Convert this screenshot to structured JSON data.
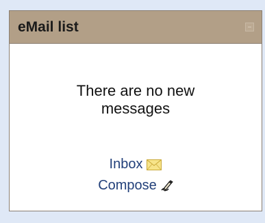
{
  "panel": {
    "title": "eMail list",
    "message": "There are no new messages",
    "links": {
      "inbox": "Inbox",
      "compose": "Compose"
    },
    "icons": {
      "collapse": "minus-icon",
      "inbox": "envelope-icon",
      "compose": "pen-writing-icon"
    },
    "colors": {
      "header": "#b29f87",
      "link": "#22407a",
      "background": "#dfe8f6"
    }
  }
}
